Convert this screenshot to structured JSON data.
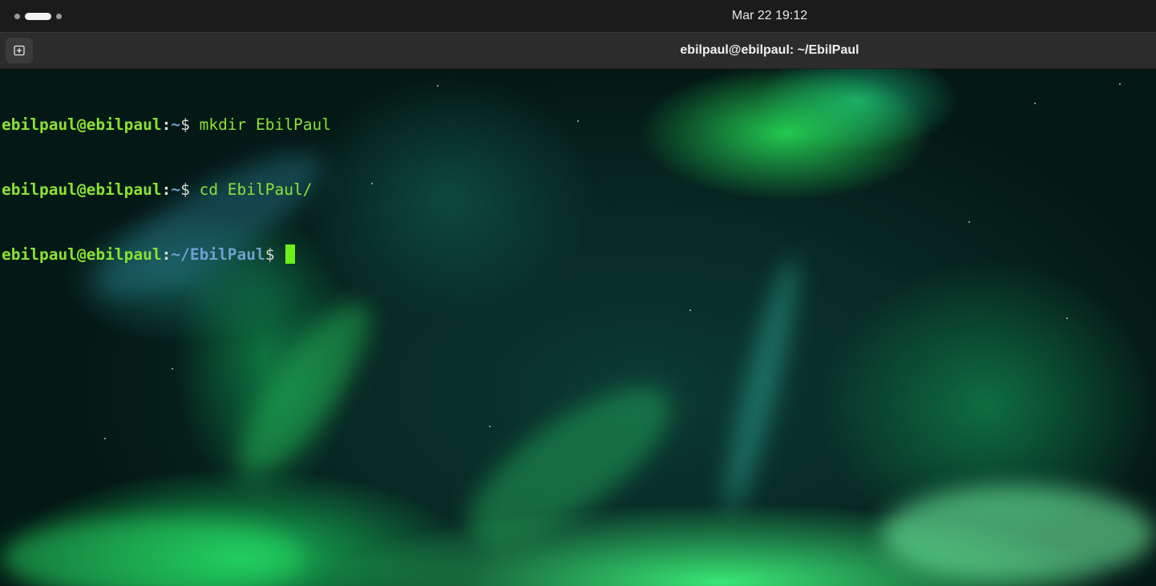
{
  "topbar": {
    "clock": "Mar 22  19:12"
  },
  "window": {
    "title": "ebilpaul@ebilpaul: ~/EbilPaul",
    "new_tab_icon": "new-tab-icon"
  },
  "terminal": {
    "lines": [
      {
        "user": "ebilpaul@ebilpaul",
        "sep": ":",
        "path": "~",
        "dollar": "$",
        "cmd": " mkdir EbilPaul"
      },
      {
        "user": "ebilpaul@ebilpaul",
        "sep": ":",
        "path": "~",
        "dollar": "$",
        "cmd": " cd EbilPaul/"
      },
      {
        "user": "ebilpaul@ebilpaul",
        "sep": ":",
        "path": "~/EbilPaul",
        "dollar": "$",
        "cmd": " "
      }
    ]
  },
  "colors": {
    "prompt_user": "#8ae234",
    "prompt_path": "#729fcf",
    "cursor": "#6cf019"
  }
}
